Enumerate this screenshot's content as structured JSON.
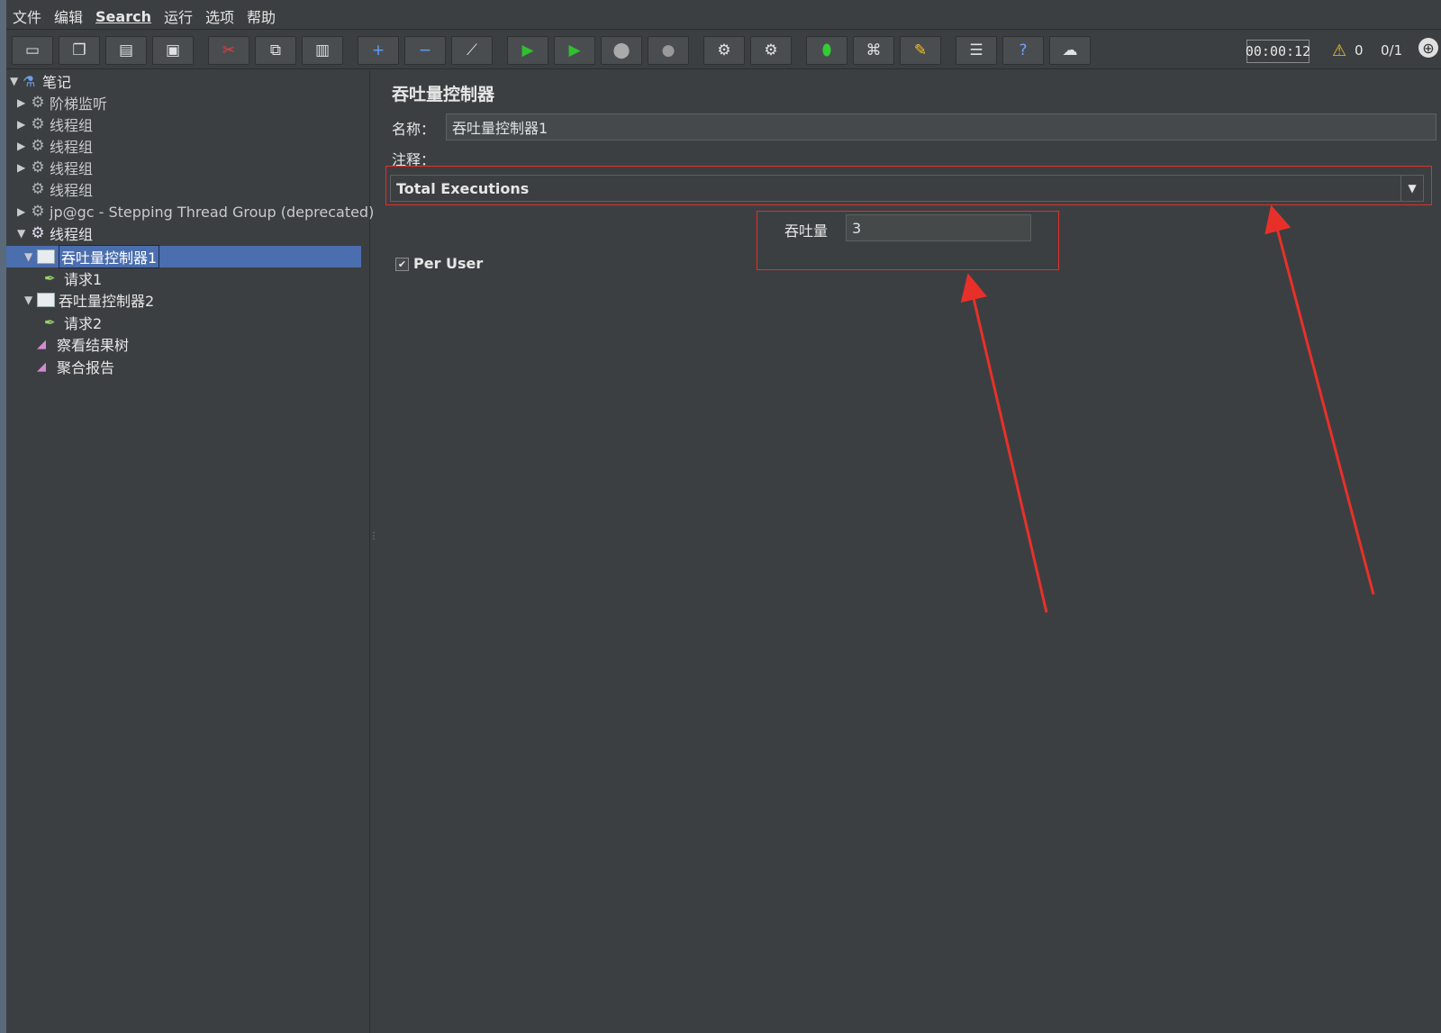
{
  "menu": [
    "文件",
    "编辑",
    "Search",
    "运行",
    "选项",
    "帮助"
  ],
  "toolbar": {
    "timer": "00:00:12",
    "warning_count": "0",
    "threads": "0/1"
  },
  "tree": {
    "root": "笔记",
    "items": [
      {
        "label": "阶梯监听"
      },
      {
        "label": "线程组"
      },
      {
        "label": "线程组"
      },
      {
        "label": "线程组"
      },
      {
        "label": "线程组"
      },
      {
        "label": "jp@gc - Stepping Thread Group (deprecated)"
      },
      {
        "label": "线程组"
      },
      {
        "label": "吞吐量控制器1"
      },
      {
        "label": "请求1"
      },
      {
        "label": "吞吐量控制器2"
      },
      {
        "label": "请求2"
      },
      {
        "label": "察看结果树"
      },
      {
        "label": "聚合报告"
      }
    ]
  },
  "panel": {
    "title": "吞吐量控制器",
    "name_label": "名称：",
    "name_value": "吞吐量控制器1",
    "comment_label": "注释：",
    "mode_value": "Total Executions",
    "throughput_label": "吞吐量",
    "throughput_value": "3",
    "per_user_label": "Per User",
    "per_user_checked": true
  },
  "annotation_color": "#e0302a"
}
